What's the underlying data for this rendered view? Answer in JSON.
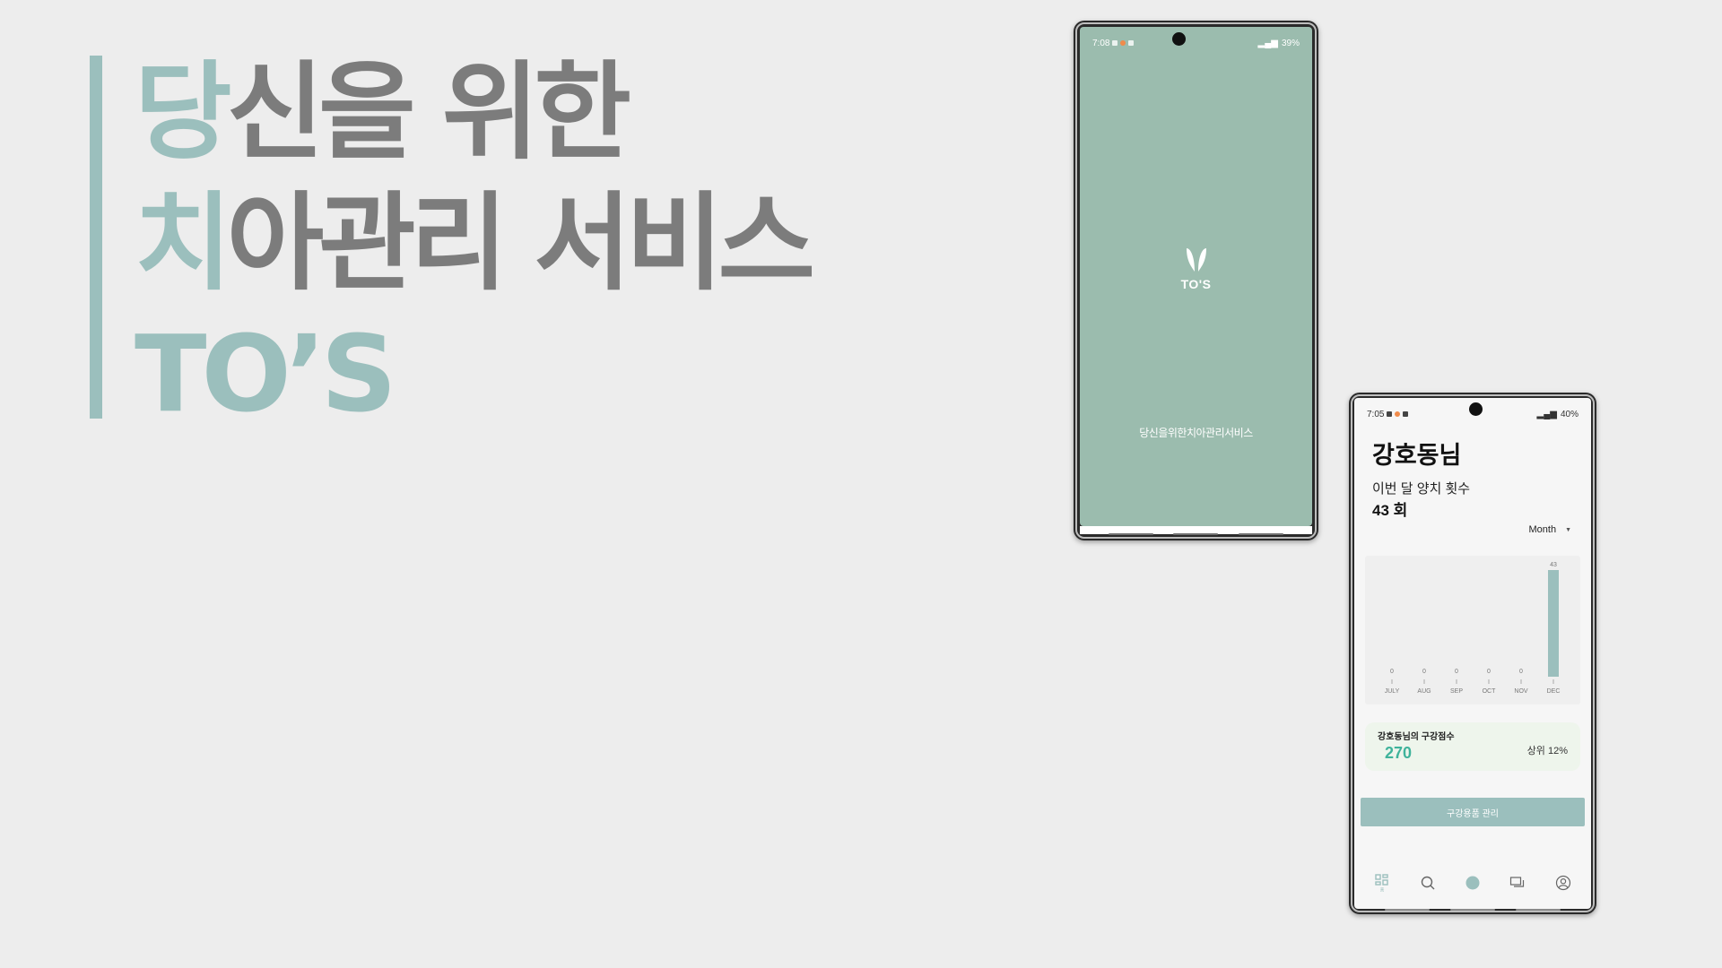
{
  "headline": {
    "line1_accent": "당",
    "line1_rest": "신을 위한",
    "line2_accent": "치",
    "line2_rest": "아관리 서비스",
    "line3": "TO’S",
    "accent_color": "#9bbfbd",
    "text_color": "#7c7c7c"
  },
  "splash_phone": {
    "status": {
      "time": "7:08",
      "battery": "39%"
    },
    "logo_text": "TO'S",
    "tagline": "당신을위한치아관리서비스",
    "background_color": "#9bbcae"
  },
  "home_phone": {
    "status": {
      "time": "7:05",
      "battery": "40%"
    },
    "user_name": "강호동님",
    "brush_label": "이번 달 양치 횟수",
    "brush_count": "43 회",
    "period_select": {
      "selected": "Month",
      "icon": "caret-down-icon"
    },
    "score_card": {
      "title": "강호동님의 구강점수",
      "value": "270",
      "rank": "상위 12%"
    },
    "manage_button_label": "구강용품 관리",
    "bottom_nav": [
      {
        "name": "nav-dashboard",
        "icon": "grid-icon",
        "label": "홈"
      },
      {
        "name": "nav-search",
        "icon": "search-icon"
      },
      {
        "name": "nav-home",
        "icon": "circle-icon"
      },
      {
        "name": "nav-chat",
        "icon": "chat-icon"
      },
      {
        "name": "nav-profile",
        "icon": "user-icon"
      }
    ],
    "accent_color": "#9bbfbd"
  },
  "chart_data": {
    "type": "bar",
    "categories": [
      "JULY",
      "AUG",
      "SEP",
      "OCT",
      "NOV",
      "DEC"
    ],
    "values": [
      0,
      0,
      0,
      0,
      0,
      43
    ],
    "data_labels": [
      "0",
      "0",
      "0",
      "0",
      "0",
      "43"
    ],
    "title": "",
    "xlabel": "",
    "ylabel": "",
    "ylim": [
      0,
      43
    ],
    "grid": false,
    "bar_color": "#9bbfbd"
  }
}
